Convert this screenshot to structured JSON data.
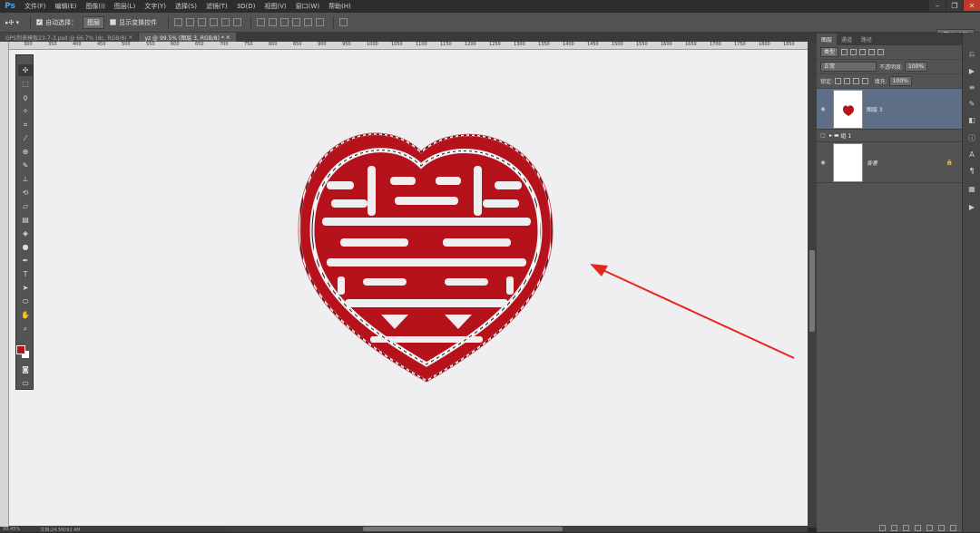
{
  "app": {
    "logo": "Ps"
  },
  "menu": [
    "文件(F)",
    "编辑(E)",
    "图像(I)",
    "图层(L)",
    "文字(Y)",
    "选择(S)",
    "滤镜(T)",
    "3D(D)",
    "视图(V)",
    "窗口(W)",
    "帮助(H)"
  ],
  "options": {
    "auto_select_label": "自动选择：",
    "auto_select_value": "图层",
    "show_transform_label": "显示变换控件",
    "workspace": "基本功能"
  },
  "tabs": [
    {
      "label": "GPS制表模板23-7-3.psd @ 66.7% (dc, RGB/8)"
    },
    {
      "label": "yz @ 99.5% (图层 3, RGB/8) *"
    }
  ],
  "ruler_ticks": [
    "300",
    "350",
    "400",
    "450",
    "500",
    "550",
    "600",
    "650",
    "700",
    "750",
    "800",
    "850",
    "900",
    "950",
    "1000",
    "1050",
    "1100",
    "1150",
    "1200",
    "1250",
    "1300",
    "1350",
    "1400",
    "1450",
    "1500",
    "1550",
    "1600",
    "1650",
    "1700",
    "1750",
    "1800",
    "1850",
    "1900"
  ],
  "status": {
    "zoom": "99.45%",
    "doc": "文档:24.5M/92.4M"
  },
  "layers_panel": {
    "tabs": [
      "图层",
      "通道",
      "路径"
    ],
    "kind": "类型",
    "blend_mode": "正常",
    "opacity_label": "不透明度:",
    "opacity_value": "100%",
    "lock_label": "锁定:",
    "fill_label": "填充:",
    "fill_value": "100%",
    "layers": [
      {
        "name": "图层 3"
      },
      {
        "name": "组 1"
      },
      {
        "name": "背景"
      }
    ]
  },
  "colors": {
    "accent_red": "#b5121b",
    "arrow_red": "#e8261e"
  }
}
